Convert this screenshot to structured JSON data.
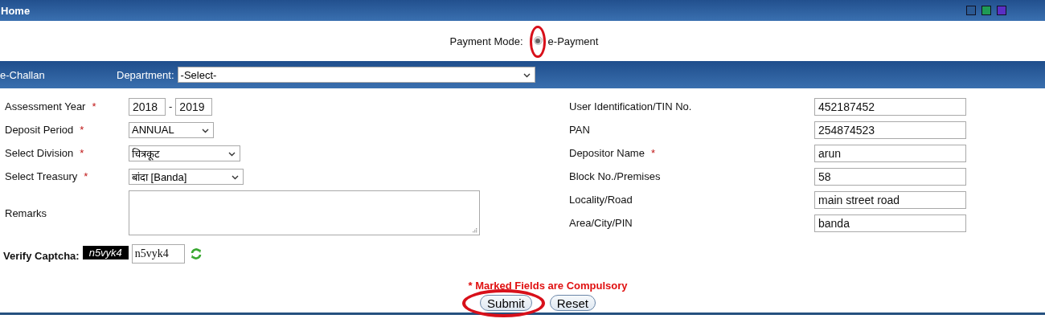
{
  "header": {
    "title": "Home",
    "theme_swatches": [
      {
        "color": "#2b5a94"
      },
      {
        "color": "#1f9a55"
      },
      {
        "color": "#5a2fc4"
      }
    ]
  },
  "payment_mode": {
    "label": "Payment Mode:",
    "option": "e-Payment",
    "selected": true,
    "highlighted": true
  },
  "section_bar": {
    "title": "e-Challan",
    "department_label": "Department:",
    "department_value": "-Select-"
  },
  "left_fields": [
    {
      "kind": "year",
      "label": "Assessment Year",
      "required": true,
      "from": "2018",
      "separator": "-",
      "to": "2019"
    },
    {
      "kind": "select",
      "label": "Deposit Period",
      "required": true,
      "value": "ANNUAL"
    },
    {
      "kind": "select",
      "label": "Select Division",
      "required": true,
      "value": "चित्रकूट"
    },
    {
      "kind": "select",
      "label": "Select Treasury",
      "required": true,
      "value": "बांदा [Banda]"
    },
    {
      "kind": "textarea",
      "label": "Remarks",
      "required": false
    }
  ],
  "right_fields": [
    {
      "label": "User Identification/TIN No.",
      "required": false,
      "value": "452187452"
    },
    {
      "label": "PAN",
      "required": false,
      "value": "254874523"
    },
    {
      "label": "Depositor Name",
      "required": true,
      "value": "arun"
    },
    {
      "label": "Block No./Premises",
      "required": false,
      "value": "58"
    },
    {
      "label": "Locality/Road",
      "required": false,
      "value": "main street road"
    },
    {
      "label": "Area/City/PIN",
      "required": false,
      "value": "banda"
    }
  ],
  "required_mark": "*",
  "captcha": {
    "label": "Verify Captcha:",
    "code": "n5vyk4",
    "value": "n5vyk4"
  },
  "note": "* Marked Fields are Compulsory",
  "buttons": [
    {
      "label": "Submit",
      "highlighted": true
    },
    {
      "label": "Reset",
      "highlighted": false
    }
  ]
}
